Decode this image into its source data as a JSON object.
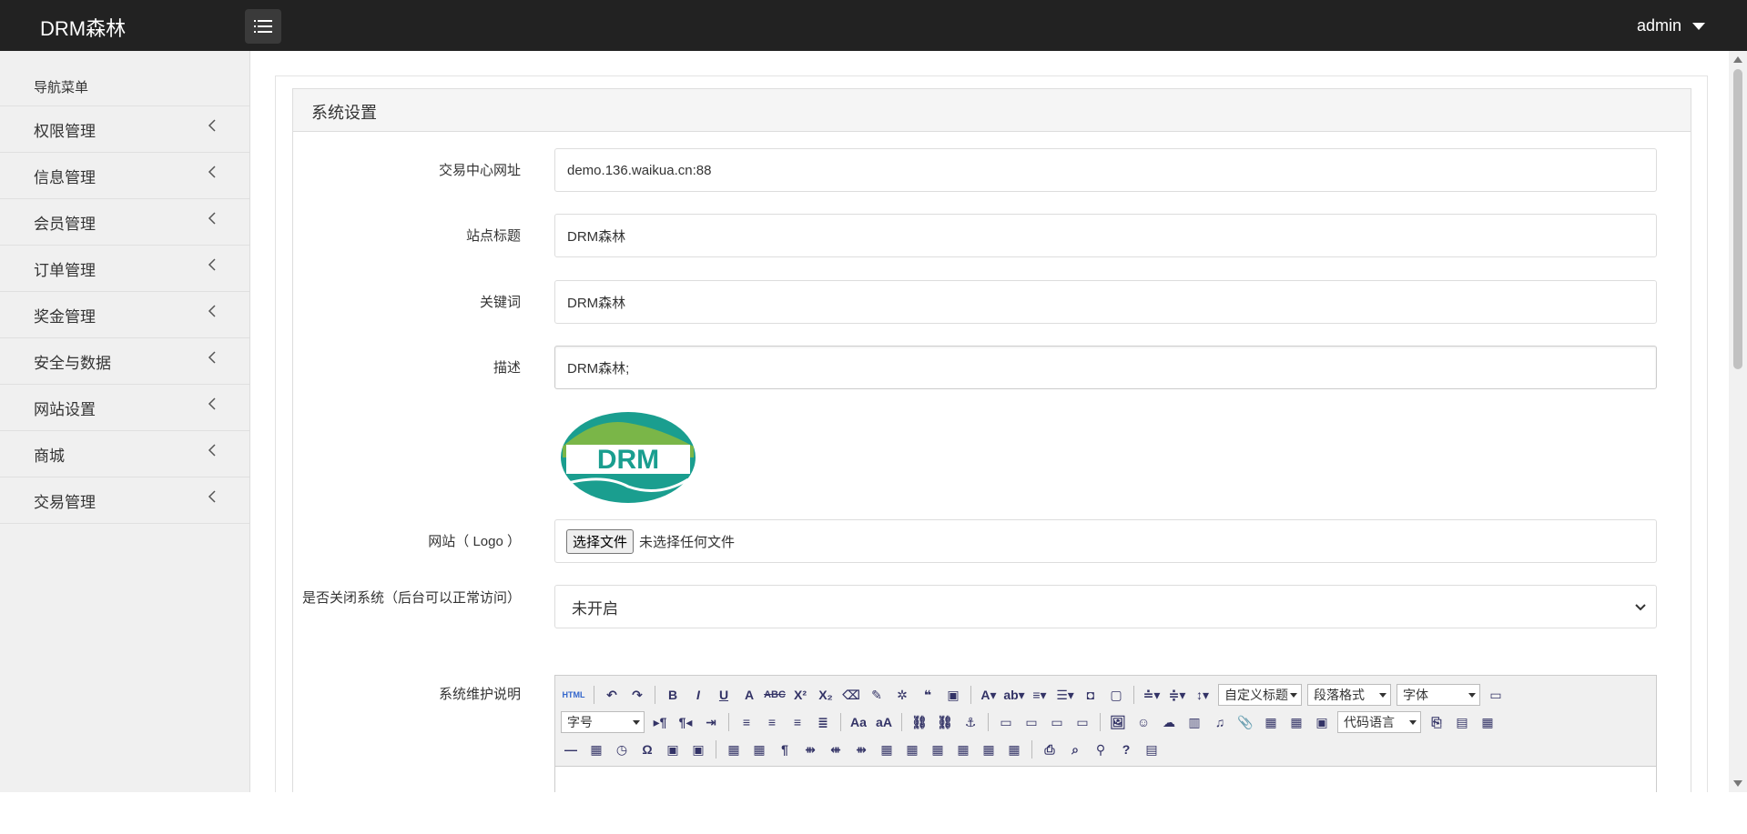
{
  "header": {
    "brand": "DRM森林",
    "user": "admin"
  },
  "sidebar": {
    "title": "导航菜单",
    "items": [
      {
        "label": "权限管理"
      },
      {
        "label": "信息管理"
      },
      {
        "label": "会员管理"
      },
      {
        "label": "订单管理"
      },
      {
        "label": "奖金管理"
      },
      {
        "label": "安全与数据"
      },
      {
        "label": "网站设置"
      },
      {
        "label": "商城"
      },
      {
        "label": "交易管理"
      }
    ]
  },
  "panel": {
    "title": "系统设置"
  },
  "form": {
    "trade_url_label": "交易中心网址",
    "trade_url_value": "demo.136.waikua.cn:88",
    "site_title_label": "站点标题",
    "site_title_value": "DRM森林",
    "keywords_label": "关键词",
    "keywords_value": "DRM森林",
    "description_label": "描述",
    "description_value": "DRM森林;",
    "logo_label": "网站（ Logo ）",
    "logo_text": "DRM",
    "file_button": "选择文件",
    "file_status": "未选择任何文件",
    "close_system_label": "是否关闭系统（后台可以正常访问）",
    "close_system_value": "未开启",
    "maintenance_label": "系统维护说明"
  },
  "editor": {
    "custom_title": "自定义标题",
    "paragraph": "段落格式",
    "font": "字体",
    "font_size": "字号",
    "code_lang": "代码语言"
  },
  "colors": {
    "topbar": "#222222",
    "sidebar": "#f0f0f0",
    "logo_green": "#7ab648",
    "logo_teal": "#1a9e8f"
  }
}
